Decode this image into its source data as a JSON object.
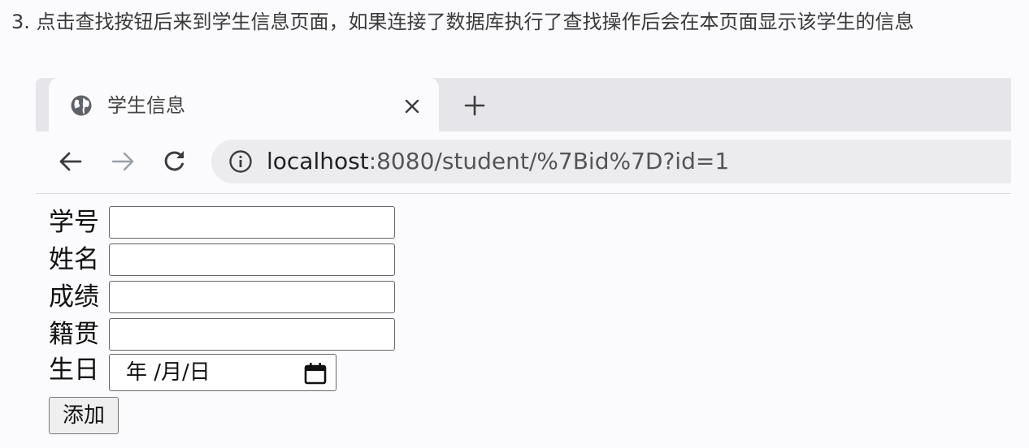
{
  "caption": "3. 点击查找按钮后来到学生信息页面，如果连接了数据库执行了查找操作后会在本页面显示该学生的信息",
  "browser": {
    "tab": {
      "title": "学生信息",
      "icon": "globe-icon",
      "close_icon": "close-icon"
    },
    "new_tab_icon": "plus-icon",
    "nav": {
      "back_icon": "arrow-left-icon",
      "forward_icon": "arrow-right-icon",
      "reload_icon": "reload-icon"
    },
    "address": {
      "icon": "info-icon",
      "host": "localhost",
      "rest": ":8080/student/%7Bid%7D?id=1"
    }
  },
  "form": {
    "fields": [
      {
        "label": "学号",
        "value": ""
      },
      {
        "label": "姓名",
        "value": ""
      },
      {
        "label": "成绩",
        "value": ""
      },
      {
        "label": "籍贯",
        "value": ""
      }
    ],
    "date_field": {
      "label": "生日",
      "display": "年 /月/日",
      "icon": "calendar-icon"
    },
    "submit_label": "添加"
  }
}
